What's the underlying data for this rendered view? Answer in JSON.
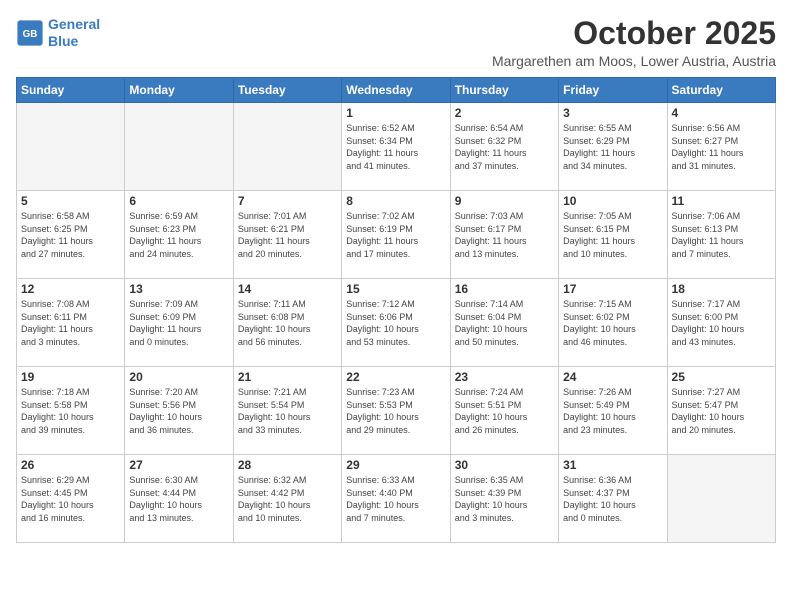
{
  "logo": {
    "line1": "General",
    "line2": "Blue"
  },
  "title": "October 2025",
  "location": "Margarethen am Moos, Lower Austria, Austria",
  "days_of_week": [
    "Sunday",
    "Monday",
    "Tuesday",
    "Wednesday",
    "Thursday",
    "Friday",
    "Saturday"
  ],
  "weeks": [
    [
      {
        "day": "",
        "info": ""
      },
      {
        "day": "",
        "info": ""
      },
      {
        "day": "",
        "info": ""
      },
      {
        "day": "1",
        "info": "Sunrise: 6:52 AM\nSunset: 6:34 PM\nDaylight: 11 hours\nand 41 minutes."
      },
      {
        "day": "2",
        "info": "Sunrise: 6:54 AM\nSunset: 6:32 PM\nDaylight: 11 hours\nand 37 minutes."
      },
      {
        "day": "3",
        "info": "Sunrise: 6:55 AM\nSunset: 6:29 PM\nDaylight: 11 hours\nand 34 minutes."
      },
      {
        "day": "4",
        "info": "Sunrise: 6:56 AM\nSunset: 6:27 PM\nDaylight: 11 hours\nand 31 minutes."
      }
    ],
    [
      {
        "day": "5",
        "info": "Sunrise: 6:58 AM\nSunset: 6:25 PM\nDaylight: 11 hours\nand 27 minutes."
      },
      {
        "day": "6",
        "info": "Sunrise: 6:59 AM\nSunset: 6:23 PM\nDaylight: 11 hours\nand 24 minutes."
      },
      {
        "day": "7",
        "info": "Sunrise: 7:01 AM\nSunset: 6:21 PM\nDaylight: 11 hours\nand 20 minutes."
      },
      {
        "day": "8",
        "info": "Sunrise: 7:02 AM\nSunset: 6:19 PM\nDaylight: 11 hours\nand 17 minutes."
      },
      {
        "day": "9",
        "info": "Sunrise: 7:03 AM\nSunset: 6:17 PM\nDaylight: 11 hours\nand 13 minutes."
      },
      {
        "day": "10",
        "info": "Sunrise: 7:05 AM\nSunset: 6:15 PM\nDaylight: 11 hours\nand 10 minutes."
      },
      {
        "day": "11",
        "info": "Sunrise: 7:06 AM\nSunset: 6:13 PM\nDaylight: 11 hours\nand 7 minutes."
      }
    ],
    [
      {
        "day": "12",
        "info": "Sunrise: 7:08 AM\nSunset: 6:11 PM\nDaylight: 11 hours\nand 3 minutes."
      },
      {
        "day": "13",
        "info": "Sunrise: 7:09 AM\nSunset: 6:09 PM\nDaylight: 11 hours\nand 0 minutes."
      },
      {
        "day": "14",
        "info": "Sunrise: 7:11 AM\nSunset: 6:08 PM\nDaylight: 10 hours\nand 56 minutes."
      },
      {
        "day": "15",
        "info": "Sunrise: 7:12 AM\nSunset: 6:06 PM\nDaylight: 10 hours\nand 53 minutes."
      },
      {
        "day": "16",
        "info": "Sunrise: 7:14 AM\nSunset: 6:04 PM\nDaylight: 10 hours\nand 50 minutes."
      },
      {
        "day": "17",
        "info": "Sunrise: 7:15 AM\nSunset: 6:02 PM\nDaylight: 10 hours\nand 46 minutes."
      },
      {
        "day": "18",
        "info": "Sunrise: 7:17 AM\nSunset: 6:00 PM\nDaylight: 10 hours\nand 43 minutes."
      }
    ],
    [
      {
        "day": "19",
        "info": "Sunrise: 7:18 AM\nSunset: 5:58 PM\nDaylight: 10 hours\nand 39 minutes."
      },
      {
        "day": "20",
        "info": "Sunrise: 7:20 AM\nSunset: 5:56 PM\nDaylight: 10 hours\nand 36 minutes."
      },
      {
        "day": "21",
        "info": "Sunrise: 7:21 AM\nSunset: 5:54 PM\nDaylight: 10 hours\nand 33 minutes."
      },
      {
        "day": "22",
        "info": "Sunrise: 7:23 AM\nSunset: 5:53 PM\nDaylight: 10 hours\nand 29 minutes."
      },
      {
        "day": "23",
        "info": "Sunrise: 7:24 AM\nSunset: 5:51 PM\nDaylight: 10 hours\nand 26 minutes."
      },
      {
        "day": "24",
        "info": "Sunrise: 7:26 AM\nSunset: 5:49 PM\nDaylight: 10 hours\nand 23 minutes."
      },
      {
        "day": "25",
        "info": "Sunrise: 7:27 AM\nSunset: 5:47 PM\nDaylight: 10 hours\nand 20 minutes."
      }
    ],
    [
      {
        "day": "26",
        "info": "Sunrise: 6:29 AM\nSunset: 4:45 PM\nDaylight: 10 hours\nand 16 minutes."
      },
      {
        "day": "27",
        "info": "Sunrise: 6:30 AM\nSunset: 4:44 PM\nDaylight: 10 hours\nand 13 minutes."
      },
      {
        "day": "28",
        "info": "Sunrise: 6:32 AM\nSunset: 4:42 PM\nDaylight: 10 hours\nand 10 minutes."
      },
      {
        "day": "29",
        "info": "Sunrise: 6:33 AM\nSunset: 4:40 PM\nDaylight: 10 hours\nand 7 minutes."
      },
      {
        "day": "30",
        "info": "Sunrise: 6:35 AM\nSunset: 4:39 PM\nDaylight: 10 hours\nand 3 minutes."
      },
      {
        "day": "31",
        "info": "Sunrise: 6:36 AM\nSunset: 4:37 PM\nDaylight: 10 hours\nand 0 minutes."
      },
      {
        "day": "",
        "info": ""
      }
    ]
  ]
}
